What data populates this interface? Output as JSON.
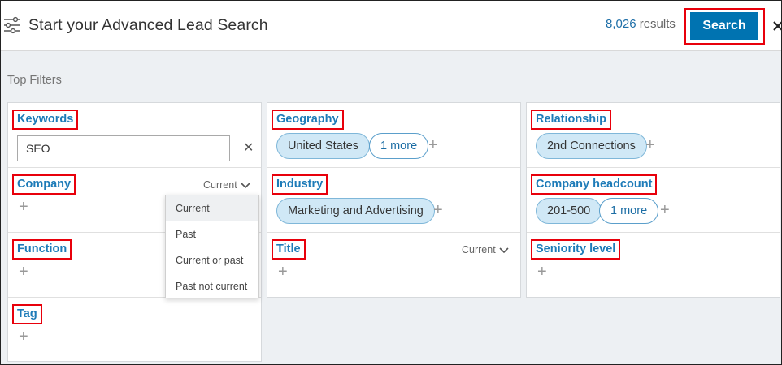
{
  "header": {
    "title": "Start your Advanced Lead Search",
    "results_count": "8,026",
    "results_suffix": "results",
    "search_label": "Search",
    "close_label": "×"
  },
  "top_filters_label": "Top Filters",
  "keywords": {
    "label": "Keywords",
    "value": "SEO",
    "clear": "✕"
  },
  "company": {
    "label": "Company",
    "toggle": "Current",
    "plus": "+"
  },
  "function": {
    "label": "Function",
    "plus": "+"
  },
  "tag": {
    "label": "Tag",
    "plus": "+"
  },
  "dropdown": {
    "items": [
      "Current",
      "Past",
      "Current or past",
      "Past not current"
    ]
  },
  "geography": {
    "label": "Geography",
    "pill": "United States",
    "more": "1 more",
    "plus": "+"
  },
  "industry": {
    "label": "Industry",
    "pill": "Marketing and Advertising",
    "plus": "+"
  },
  "title": {
    "label": "Title",
    "toggle": "Current",
    "plus": "+"
  },
  "relationship": {
    "label": "Relationship",
    "pill": "2nd Connections",
    "plus": "+"
  },
  "headcount": {
    "label": "Company headcount",
    "pill": "201-500",
    "more": "1 more",
    "plus": "+"
  },
  "seniority": {
    "label": "Seniority level",
    "plus": "+"
  },
  "colors": {
    "accent": "#0073b1",
    "label_blue": "#1d7bb8",
    "highlight_red": "#e8000b",
    "pill_fill": "#d0e8f6",
    "background": "#edf0f3"
  }
}
